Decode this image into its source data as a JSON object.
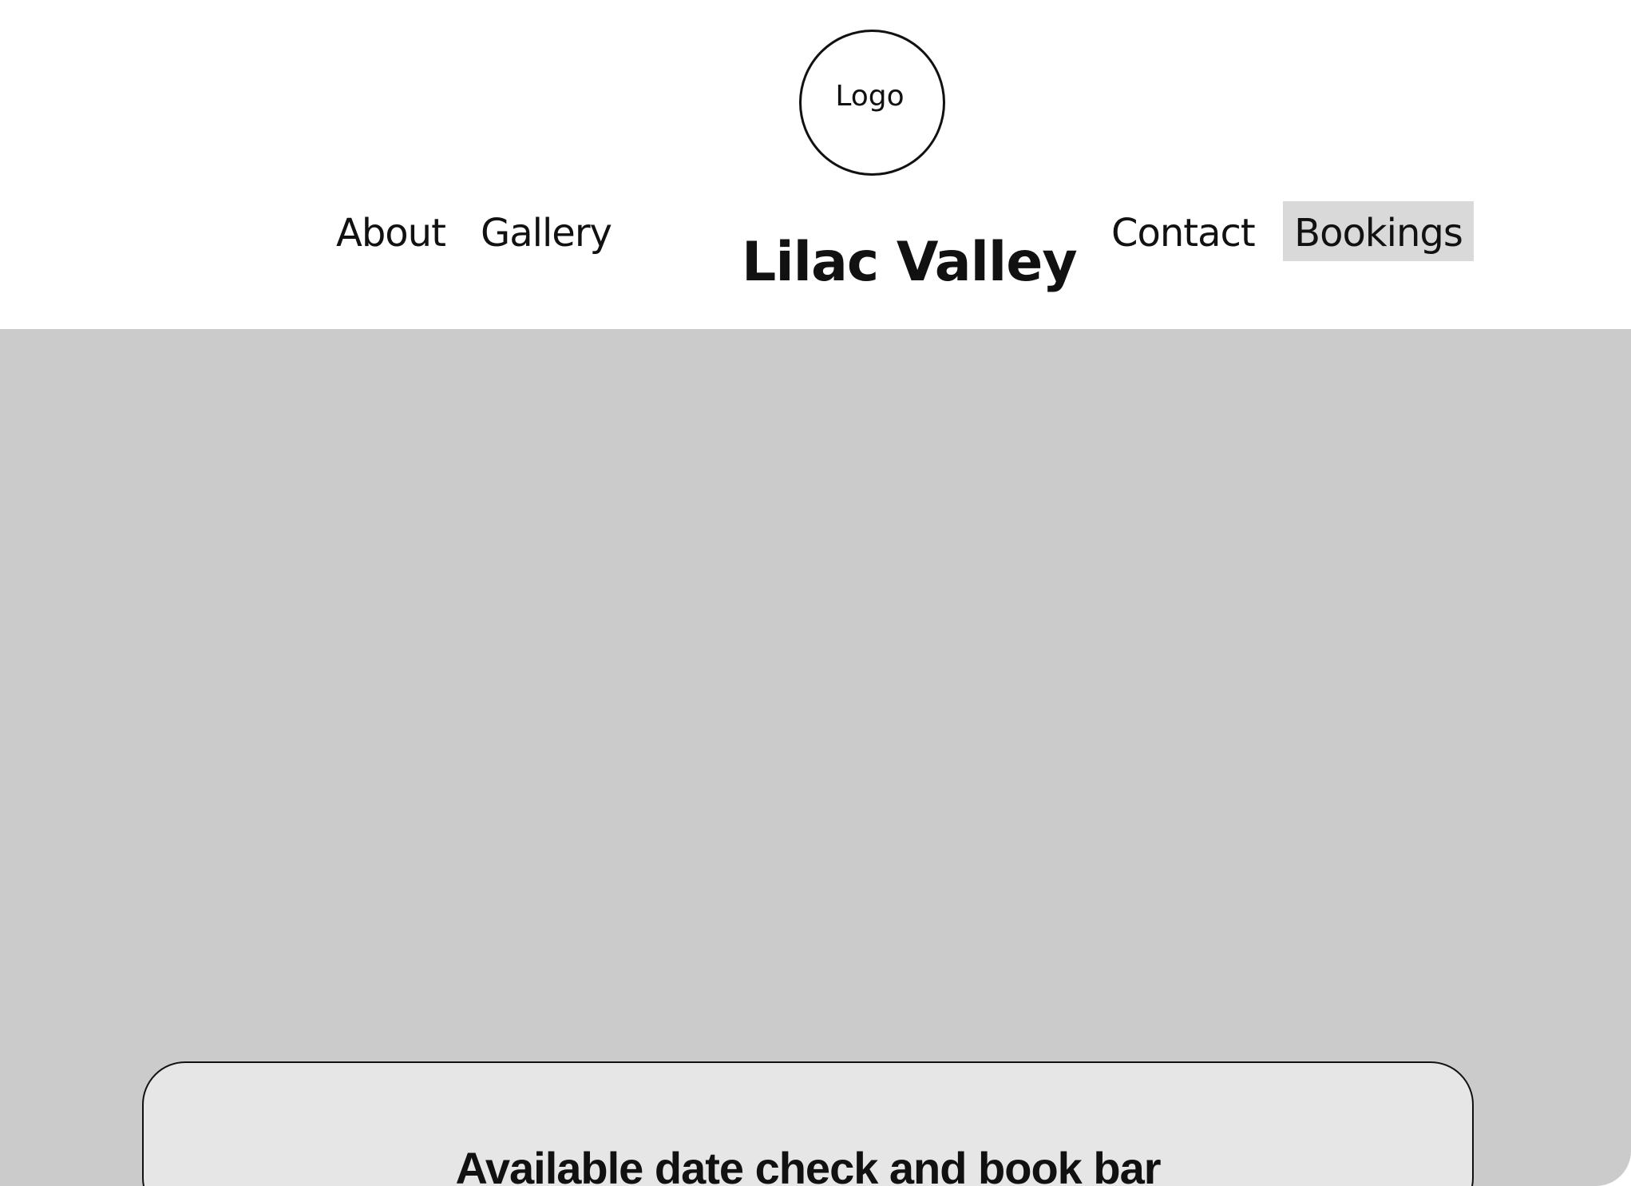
{
  "header": {
    "logo_text": "Logo",
    "site_title": "Lilac Valley",
    "nav": {
      "about": "About",
      "gallery": "Gallery",
      "contact": "Contact",
      "bookings": "Bookings"
    }
  },
  "hero": {
    "background_color": "#cbcbcb"
  },
  "booking_bar": {
    "label": "Available date check and book bar",
    "background_color": "#e6e6e6"
  },
  "colors": {
    "active_nav_background": "#d9d9d9",
    "text": "#111111"
  }
}
